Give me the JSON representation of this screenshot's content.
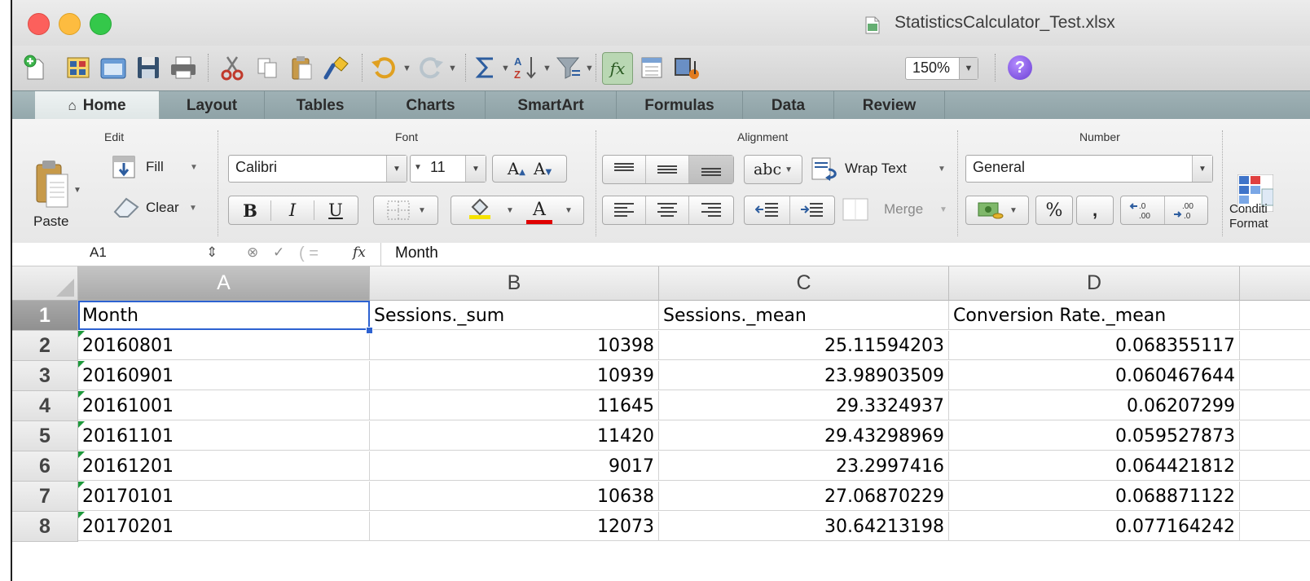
{
  "window": {
    "title": "StatisticsCalculator_Test.xlsx"
  },
  "toolbar": {
    "zoom_value": "150%",
    "icons": [
      "new-icon",
      "gallery-icon",
      "open-icon",
      "save-icon",
      "print-icon",
      "cut-icon",
      "copy-icon",
      "paste-icon",
      "format-painter-icon",
      "undo-icon",
      "redo-icon",
      "autosum-icon",
      "sort-icon",
      "filter-icon",
      "formula-builder-icon",
      "show-hide-icon",
      "media-browser-icon",
      "help-icon"
    ],
    "help_label": "?"
  },
  "tabs": [
    "Home",
    "Layout",
    "Tables",
    "Charts",
    "SmartArt",
    "Formulas",
    "Data",
    "Review"
  ],
  "ribbon": {
    "edit": {
      "title": "Edit",
      "paste": "Paste",
      "fill": "Fill",
      "clear": "Clear"
    },
    "font": {
      "title": "Font",
      "name": "Calibri",
      "size": "11",
      "bold": "B",
      "italic": "I",
      "underline": "U",
      "grow": "A",
      "shrink": "A",
      "font_color": "A",
      "highlight_color": "#f5e200",
      "text_color": "#e00000"
    },
    "alignment": {
      "title": "Alignment",
      "orientation": "abc",
      "wrap_text": "Wrap Text",
      "merge": "Merge"
    },
    "number": {
      "title": "Number",
      "format": "General",
      "percent": "%",
      "comma": ",",
      "increase_decimal": ".0 .00",
      "decrease_decimal": ".00 .0"
    },
    "format": {
      "conditional_line1": "Conditi",
      "conditional_line2": "Format"
    }
  },
  "formula_bar": {
    "cell_ref": "A1",
    "fx": "fx",
    "content": "Month"
  },
  "sheet": {
    "columns": [
      "A",
      "B",
      "C",
      "D"
    ],
    "rows": [
      {
        "num": "1",
        "cells": [
          "Month",
          "Sessions._sum",
          "Sessions._mean",
          "Conversion Rate._mean"
        ]
      },
      {
        "num": "2",
        "cells": [
          "20160801",
          "10398",
          "25.11594203",
          "0.068355117"
        ]
      },
      {
        "num": "3",
        "cells": [
          "20160901",
          "10939",
          "23.98903509",
          "0.060467644"
        ]
      },
      {
        "num": "4",
        "cells": [
          "20161001",
          "11645",
          "29.3324937",
          "0.06207299"
        ]
      },
      {
        "num": "5",
        "cells": [
          "20161101",
          "11420",
          "29.43298969",
          "0.059527873"
        ]
      },
      {
        "num": "6",
        "cells": [
          "20161201",
          "9017",
          "23.2997416",
          "0.064421812"
        ]
      },
      {
        "num": "7",
        "cells": [
          "20170101",
          "10638",
          "27.06870229",
          "0.068871122"
        ]
      },
      {
        "num": "8",
        "cells": [
          "20170201",
          "12073",
          "30.64213198",
          "0.077164242"
        ]
      }
    ]
  }
}
